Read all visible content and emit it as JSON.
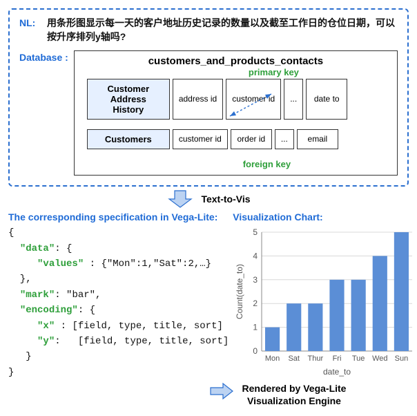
{
  "nl": {
    "label": "NL:",
    "text": "用条形图显示每一天的客户地址历史记录的数量以及截至工作日的仓位日期，可以按升序排列y轴吗?"
  },
  "database": {
    "label": "Database :",
    "schema_name": "customers_and_products_contacts",
    "pk_label": "primary key",
    "fk_label": "foreign key",
    "tables": [
      {
        "name": "Customer Address History",
        "columns": [
          "address id",
          "customer id",
          "...",
          "date to"
        ]
      },
      {
        "name": "Customers",
        "columns": [
          "customer id",
          "order id",
          "...",
          "email"
        ]
      }
    ]
  },
  "text_to_vis": "Text-to-Vis",
  "spec": {
    "header": "The corresponding specification in Vega-Lite:",
    "lines": {
      "open": "{",
      "data_key": "\"data\"",
      "data_open": ": {",
      "values_key": "\"values\"",
      "values_body": " : {\"Mon\":1,\"Sat\":2,…}",
      "data_close": "  },",
      "mark_key": "\"mark\"",
      "mark_body": ": \"bar\",",
      "enc_key": "\"encoding\"",
      "enc_open": ": {",
      "x_key": "\"x\"",
      "x_body": " : [field, type, title, sort]",
      "y_key": "\"y\"",
      "y_body": ":   [field, type, title, sort]",
      "enc_close": "   }",
      "close": "}"
    }
  },
  "viz": {
    "header": "Visualization Chart:"
  },
  "render": {
    "line1": "Rendered by Vega-Lite",
    "line2": "Visualization Engine"
  },
  "chart_data": {
    "type": "bar",
    "categories": [
      "Mon",
      "Sat",
      "Thur",
      "Fri",
      "Tue",
      "Wed",
      "Sun"
    ],
    "values": [
      1,
      2,
      2,
      3,
      3,
      4,
      5
    ],
    "xlabel": "date_to",
    "ylabel": "Count(date_to)",
    "ylim": [
      0,
      5
    ]
  }
}
